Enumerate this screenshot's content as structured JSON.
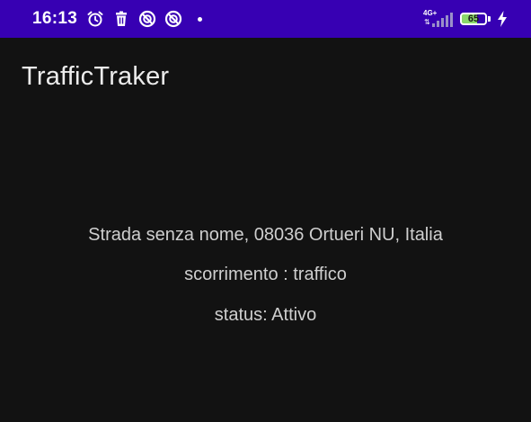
{
  "status_bar": {
    "time": "16:13",
    "network": "4G+",
    "battery": "65",
    "icons": [
      "alarm-icon",
      "trash-icon",
      "do-not-disturb-icon",
      "do-not-disturb-icon",
      "dot-icon",
      "signal-icon",
      "battery-icon",
      "charging-icon"
    ],
    "background_color": "#3700b3"
  },
  "app_bar": {
    "title": "TrafficTraker"
  },
  "main": {
    "address": "Strada senza nome, 08036 Ortueri NU, Italia",
    "flow": "scorrimento : traffico",
    "status": "status: Attivo"
  },
  "colors": {
    "background": "#121212",
    "text_primary": "#ececec",
    "text_secondary": "#cfcfcf",
    "battery_fill": "#8bd96b"
  }
}
